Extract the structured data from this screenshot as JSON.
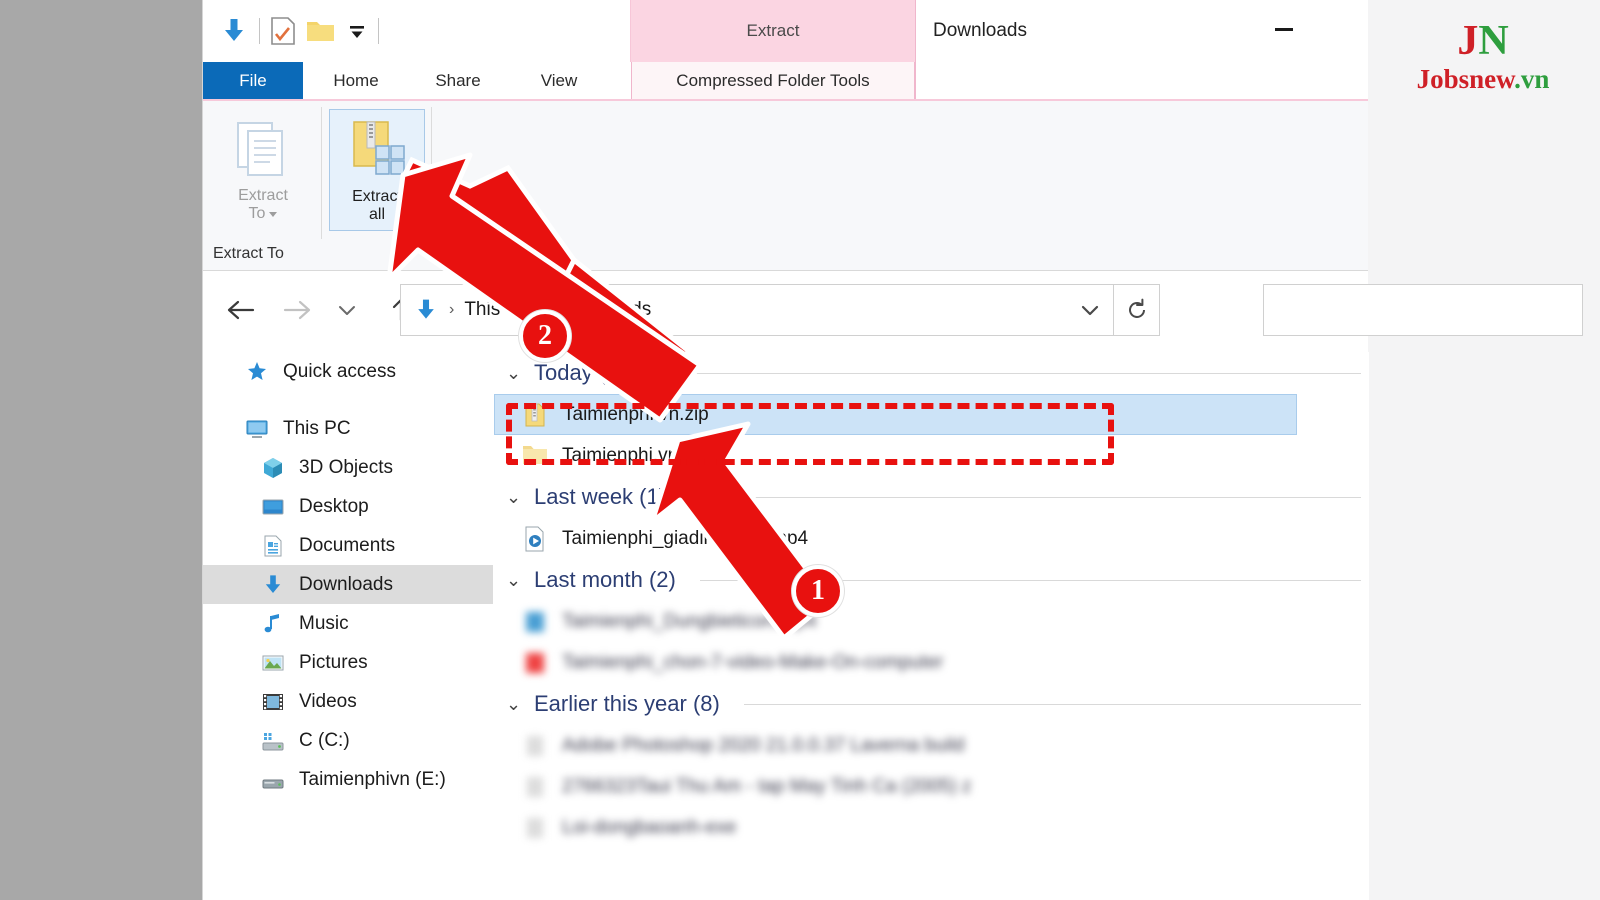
{
  "window": {
    "title": "Downloads",
    "minimize_label": "Minimize"
  },
  "quick_access_toolbar": {
    "items": [
      {
        "name": "downloads-icon",
        "label": "Downloads"
      },
      {
        "name": "properties-icon",
        "label": "Properties"
      },
      {
        "name": "new-folder-icon",
        "label": "New folder"
      },
      {
        "name": "customize-icon",
        "label": "Customize Quick Access Toolbar"
      }
    ]
  },
  "ribbon": {
    "contextual_header": "Extract",
    "tabs": [
      {
        "label": "File",
        "active": false,
        "style": "file"
      },
      {
        "label": "Home",
        "active": false,
        "style": "normal"
      },
      {
        "label": "Share",
        "active": false,
        "style": "normal"
      },
      {
        "label": "View",
        "active": false,
        "style": "normal"
      },
      {
        "label": "Compressed Folder Tools",
        "active": true,
        "style": "contextual"
      }
    ],
    "groups": [
      {
        "label": "Extract To",
        "buttons": [
          {
            "label_line1": "Extract",
            "label_line2": "To",
            "icon": "extract-to-icon",
            "state": "disabled",
            "has_dropdown": true
          },
          {
            "label_line1": "Extract",
            "label_line2": "all",
            "icon": "extract-all-icon",
            "state": "selected",
            "has_dropdown": false
          }
        ]
      }
    ]
  },
  "address_bar": {
    "back_label": "Back",
    "forward_label": "Forward",
    "recent_label": "Recent locations",
    "up_label": "Up one level",
    "path_icon": "downloads-icon",
    "crumbs": [
      "This PC",
      "Downloads"
    ],
    "crumb_separator": "›",
    "dropdown_label": "Previous locations",
    "refresh_label": "Refresh",
    "search_placeholder": ""
  },
  "nav_pane": {
    "items": [
      {
        "label": "Quick access",
        "icon": "star-pin-icon",
        "indent": 0,
        "selected": false
      },
      {
        "label": "This PC",
        "icon": "monitor-icon",
        "indent": 0,
        "selected": false
      },
      {
        "label": "3D Objects",
        "icon": "cube-icon",
        "indent": 1,
        "selected": false
      },
      {
        "label": "Desktop",
        "icon": "desktop-icon",
        "indent": 1,
        "selected": false
      },
      {
        "label": "Documents",
        "icon": "document-icon",
        "indent": 1,
        "selected": false
      },
      {
        "label": "Downloads",
        "icon": "downloads-icon",
        "indent": 1,
        "selected": true
      },
      {
        "label": "Music",
        "icon": "music-note-icon",
        "indent": 1,
        "selected": false
      },
      {
        "label": "Pictures",
        "icon": "picture-icon",
        "indent": 1,
        "selected": false
      },
      {
        "label": "Videos",
        "icon": "video-icon",
        "indent": 1,
        "selected": false
      },
      {
        "label": "C (C:)",
        "icon": "drive-icon",
        "indent": 1,
        "selected": false
      },
      {
        "label": "Taimienphivn (E:)",
        "icon": "drive-removable-icon",
        "indent": 1,
        "selected": false
      }
    ]
  },
  "file_list": {
    "groups": [
      {
        "title": "Today (2)",
        "expanded": true,
        "rows": [
          {
            "name": "Taimienphi.vn.zip",
            "icon": "zip-icon",
            "selected": true,
            "blurred": false
          },
          {
            "name": "Taimienphi.vn",
            "icon": "folder-icon",
            "selected": false,
            "blurred": false
          }
        ]
      },
      {
        "title": "Last week (1)",
        "expanded": true,
        "rows": [
          {
            "name": "Taimienphi_giadinhbac...mp4",
            "icon": "video-file-icon",
            "selected": false,
            "blurred": false
          }
        ]
      },
      {
        "title": "Last month (2)",
        "expanded": true,
        "rows": [
          {
            "name": "Taimienphi_Dungbieticon.mp4",
            "icon": "blue-file-icon",
            "selected": false,
            "blurred": true
          },
          {
            "name": "Taimienphi_chon-7-video-Make-On-computer",
            "icon": "red-file-icon",
            "selected": false,
            "blurred": true
          }
        ]
      },
      {
        "title": "Earlier this year (8)",
        "expanded": true,
        "rows": [
          {
            "name": "Adobe Photoshop 2020 21.0.0.37 Laverna build",
            "icon": "generic-file-icon",
            "selected": false,
            "blurred": true
          },
          {
            "name": "2766323Taui Thu Am - tap May Tinh Ca (2005) z",
            "icon": "generic-file-icon",
            "selected": false,
            "blurred": true
          },
          {
            "name": "Loi-dongbaoanh-exe",
            "icon": "generic-file-icon",
            "selected": false,
            "blurred": true
          }
        ]
      }
    ]
  },
  "annotations": {
    "badges": [
      {
        "number": "1",
        "target": "selected-file-row"
      },
      {
        "number": "2",
        "target": "extract-all-button"
      }
    ],
    "highlight_color": "#e8110f",
    "arrow_color": "#e8110f"
  },
  "watermark": {
    "mark_first": "J",
    "mark_second": "N",
    "word_first": "Jobsnew",
    "word_second": ".vn",
    "color_red": "#cf2027",
    "color_green": "#2e9e3e"
  }
}
